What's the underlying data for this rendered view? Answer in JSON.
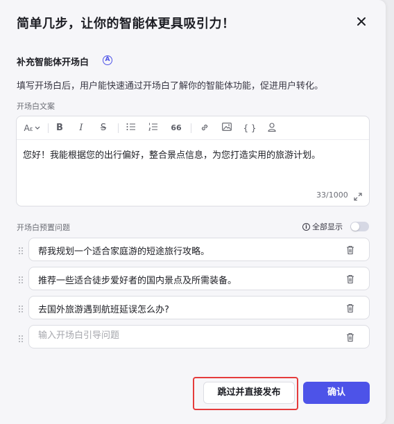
{
  "modal": {
    "title": "简单几步，让你的智能体更具吸引力！"
  },
  "section": {
    "title": "补充智能体开场白",
    "ai_icon_glyph": "A",
    "description": "填写开场白后，用户能快速通过开场白了解你的智能体功能，促进用户转化。"
  },
  "editor": {
    "label": "开场白文案",
    "content": "您好！我能根据您的出行偏好，整合景点信息，为您打造实用的旅游计划。",
    "counter": "33/1000",
    "toolbar": {
      "font_size_glyph": "A",
      "bold_glyph": "B",
      "italic_glyph": "I",
      "strike_glyph": "S",
      "quote_glyph": "66",
      "code_glyph": "{ }"
    }
  },
  "questions": {
    "label": "开场白预置问题",
    "show_all_label": "全部显示",
    "info_glyph": "i",
    "show_all_enabled": false,
    "items": [
      "帮我规划一个适合家庭游的短途旅行攻略。",
      "推荐一些适合徒步爱好者的国内景点及所需装备。",
      "去国外旅游遇到航班延误怎么办?"
    ],
    "new_placeholder": "输入开场白引导问题"
  },
  "footer": {
    "skip_label": "跳过并直接发布",
    "confirm_label": "确认"
  },
  "colors": {
    "accent": "#4d53e8",
    "highlight_border": "#e53b3b",
    "background": "#f6f6f9"
  },
  "icons": {
    "close": "close-icon",
    "drag": "drag-handle-icon",
    "trash": "trash-icon",
    "expand": "expand-icon"
  }
}
